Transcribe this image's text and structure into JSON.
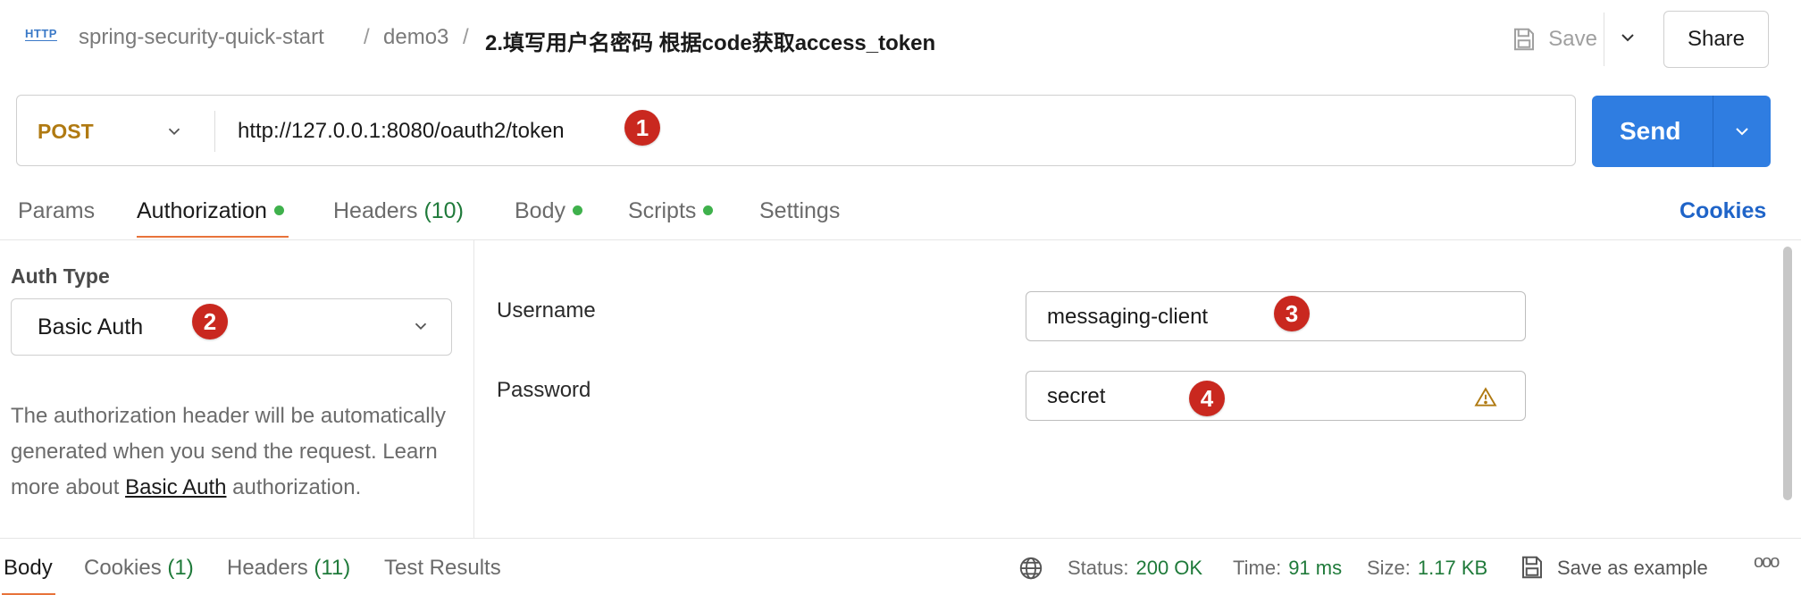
{
  "header": {
    "icon_label": "HTTP",
    "breadcrumb": [
      "spring-security-quick-start",
      "demo3"
    ],
    "separator": "/",
    "title": "2.填写用户名密码 根据code获取access_token",
    "save_label": "Save",
    "share_label": "Share"
  },
  "request": {
    "method": "POST",
    "url": "http://127.0.0.1:8080/oauth2/token",
    "send_label": "Send"
  },
  "tabs": [
    {
      "label": "Params",
      "count": "",
      "dot": false,
      "active": false
    },
    {
      "label": "Authorization",
      "count": "",
      "dot": true,
      "active": true
    },
    {
      "label": "Headers",
      "count": "(10)",
      "dot": false,
      "active": false
    },
    {
      "label": "Body",
      "count": "",
      "dot": true,
      "active": false
    },
    {
      "label": "Scripts",
      "count": "",
      "dot": true,
      "active": false
    },
    {
      "label": "Settings",
      "count": "",
      "dot": false,
      "active": false
    }
  ],
  "cookies_link": "Cookies",
  "auth": {
    "type_label": "Auth Type",
    "type_value": "Basic Auth",
    "description_prefix": "The authorization header will be automatically generated when you send the request. Learn more about ",
    "description_link": "Basic Auth",
    "description_suffix": " authorization.",
    "username_label": "Username",
    "username_value": "messaging-client",
    "password_label": "Password",
    "password_value": "secret"
  },
  "annotations": [
    "1",
    "2",
    "3",
    "4"
  ],
  "bottom_tabs": [
    {
      "label": "Body",
      "count": "",
      "active": true
    },
    {
      "label": "Cookies",
      "count": "(1)",
      "active": false
    },
    {
      "label": "Headers",
      "count": "(11)",
      "active": false
    },
    {
      "label": "Test Results",
      "count": "",
      "active": false
    }
  ],
  "response": {
    "status_label": "Status:",
    "status_value": "200 OK",
    "time_label": "Time:",
    "time_value": "91 ms",
    "size_label": "Size:",
    "size_value": "1.17 KB",
    "save_example_label": "Save as example",
    "more_label": "ooo"
  },
  "colors": {
    "accent": "#2f7de1",
    "method": "#b07a12",
    "active_tab_underline": "#e8733a",
    "dot": "#3fb14c",
    "annotation_badge": "#c9281f",
    "status_ok": "#1f7a3a"
  }
}
